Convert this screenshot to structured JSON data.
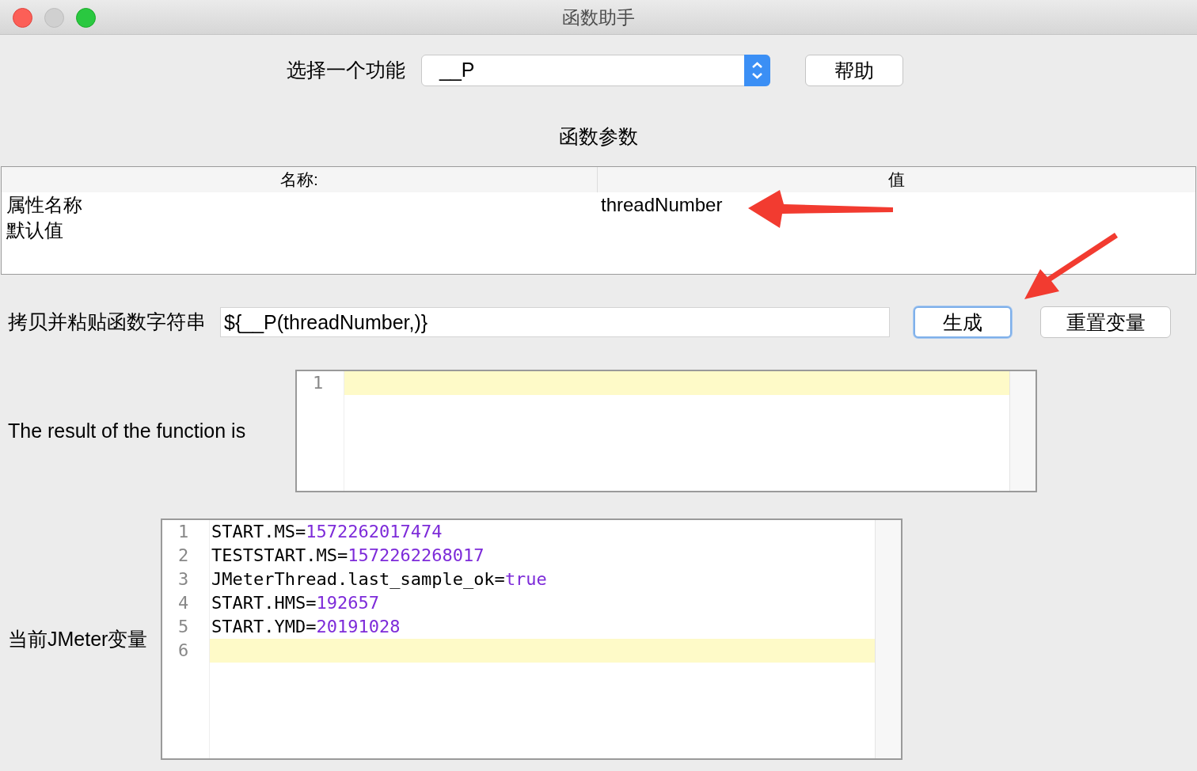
{
  "window": {
    "title": "函数助手"
  },
  "function_select": {
    "label": "选择一个功能",
    "value": "__P"
  },
  "help_button": {
    "label": "帮助"
  },
  "parameters": {
    "title": "函数参数",
    "columns": [
      "名称:",
      "值"
    ],
    "rows": [
      {
        "name": "属性名称",
        "value": "threadNumber"
      },
      {
        "name": "默认值"
      }
    ]
  },
  "function_string": {
    "label": "拷贝并粘贴函数字符串",
    "value": "${__P(threadNumber,)}"
  },
  "buttons": [
    {
      "label": "生成",
      "focused": true
    },
    {
      "label": "重置变量",
      "focused": false
    }
  ],
  "result": {
    "label": "The result of the function is",
    "lines": [
      {
        "number": "1",
        "current": true
      }
    ]
  },
  "variables": {
    "label": "当前JMeter变量",
    "lines": [
      {
        "number": "1",
        "text": "START.MS=1572262017474",
        "current": false
      },
      {
        "number": "2",
        "text": "TESTSTART.MS=1572262268017",
        "current": false
      },
      {
        "number": "3",
        "text": "JMeterThread.last_sample_ok=true",
        "current": false
      },
      {
        "number": "4",
        "text": "START.HMS=192657",
        "current": false
      },
      {
        "number": "5",
        "text": "START.YMD=20191028",
        "current": false
      },
      {
        "number": "6",
        "current": true
      }
    ]
  }
}
